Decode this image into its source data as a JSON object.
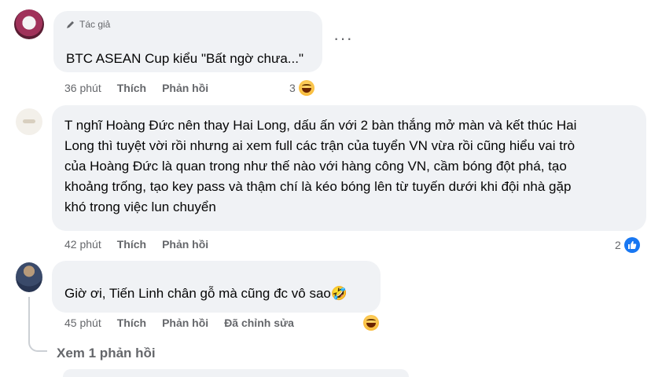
{
  "comments": [
    {
      "author_tag": "Tác giả",
      "text": "BTC ASEAN Cup kiểu \"Bất ngờ chưa...\"",
      "time": "36 phút",
      "like_label": "Thích",
      "reply_label": "Phản hồi",
      "reaction_count": "3",
      "reaction_icon": "haha-emoji-icon"
    },
    {
      "text_lines": [
        "T nghĩ Hoàng Đức nên thay Hai Long, dấu ấn với 2 bàn thắng mở màn và kết thúc Hai",
        "Long thì tuyệt vời rồi nhưng ai xem full các trận của tuyển VN vừa rồi cũng hiểu vai trò",
        "của Hoàng Đức là quan trong như thế nào với hàng công VN, cầm bóng đột phá, tạo",
        "khoảng trống, tạo key pass và thậm chí là kéo bóng lên từ tuyến dưới khi đội nhà gặp",
        "khó trong việc lun chuyển"
      ],
      "time": "42 phút",
      "like_label": "Thích",
      "reply_label": "Phản hồi",
      "reaction_count": "2",
      "reaction_icon": "like-icon"
    },
    {
      "text": "Giờ ơi, Tiến Linh chân gỗ mà cũng đc vô sao🤣",
      "time": "45 phút",
      "like_label": "Thích",
      "reply_label": "Phản hồi",
      "edited_label": "Đã chỉnh sửa",
      "reaction_icon": "haha-emoji-icon"
    }
  ],
  "view_replies_label": "Xem 1 phản hồi",
  "colors": {
    "bubble": "#f0f2f5",
    "meta": "#65676b",
    "like_blue": "#1877f2"
  }
}
